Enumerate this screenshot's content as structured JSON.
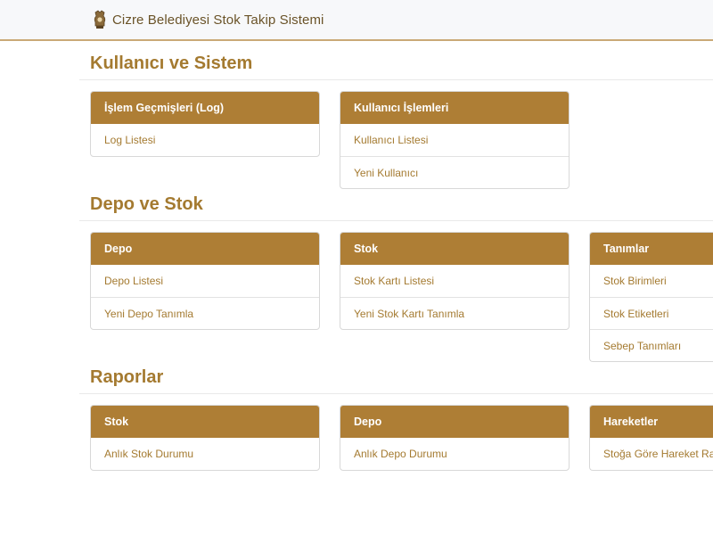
{
  "navbar": {
    "title": "Cizre Belediyesi Stok Takip Sistemi",
    "logo_icon": "municipality-emblem-icon"
  },
  "theme": {
    "accent": "#ae7e35",
    "accent_text": "#a47a30",
    "navbar_bg": "#f7f8fa"
  },
  "sections": [
    {
      "title": "Kullanıcı ve Sistem",
      "cards": [
        {
          "header": "İşlem Geçmişleri (Log)",
          "items": [
            "Log Listesi"
          ]
        },
        {
          "header": "Kullanıcı İşlemleri",
          "items": [
            "Kullanıcı Listesi",
            "Yeni Kullanıcı"
          ]
        }
      ]
    },
    {
      "title": "Depo ve Stok",
      "cards": [
        {
          "header": "Depo",
          "items": [
            "Depo Listesi",
            "Yeni Depo Tanımla"
          ]
        },
        {
          "header": "Stok",
          "items": [
            "Stok Kartı Listesi",
            "Yeni Stok Kartı Tanımla"
          ]
        },
        {
          "header": "Tanımlar",
          "items": [
            "Stok Birimleri",
            "Stok Etiketleri",
            "Sebep Tanımları"
          ]
        }
      ]
    },
    {
      "title": "Raporlar",
      "cards": [
        {
          "header": "Stok",
          "items": [
            "Anlık Stok Durumu"
          ]
        },
        {
          "header": "Depo",
          "items": [
            "Anlık Depo Durumu"
          ]
        },
        {
          "header": "Hareketler",
          "items": [
            "Stoğa Göre Hareket Raporu"
          ]
        }
      ]
    }
  ]
}
